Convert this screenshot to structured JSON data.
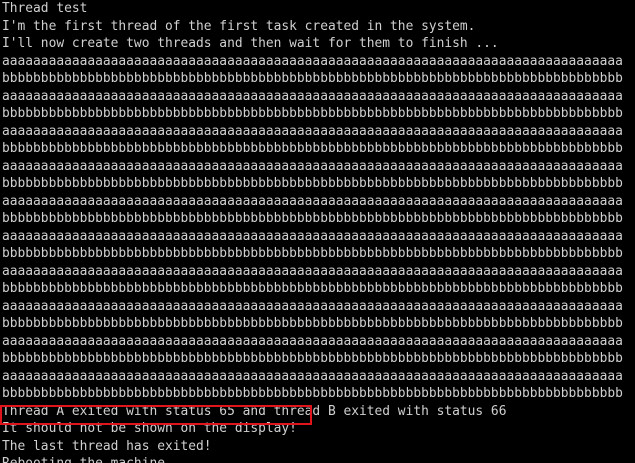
{
  "window": {
    "title": "Thread test"
  },
  "terminal": {
    "lines": [
      "Thread test",
      "I'm the first thread of the first task created in the system.",
      "I'll now create two threads and then wait for them to finish ...",
      "aaaaaaaaaaaaaaaaaaaaaaaaaaaaaaaaaaaaaaaaaaaaaaaaaaaaaaaaaaaaaaaaaaaaaaaaaaaaaaaa",
      "bbbbbbbbbbbbbbbbbbbbbbbbbbbbbbbbbbbbbbbbbbbbbbbbbbbbbbbbbbbbbbbbbbbbbbbbbbbbbbbb",
      "aaaaaaaaaaaaaaaaaaaaaaaaaaaaaaaaaaaaaaaaaaaaaaaaaaaaaaaaaaaaaaaaaaaaaaaaaaaaaaaa",
      "bbbbbbbbbbbbbbbbbbbbbbbbbbbbbbbbbbbbbbbbbbbbbbbbbbbbbbbbbbbbbbbbbbbbbbbbbbbbbbbb",
      "aaaaaaaaaaaaaaaaaaaaaaaaaaaaaaaaaaaaaaaaaaaaaaaaaaaaaaaaaaaaaaaaaaaaaaaaaaaaaaaa",
      "bbbbbbbbbbbbbbbbbbbbbbbbbbbbbbbbbbbbbbbbbbbbbbbbbbbbbbbbbbbbbbbbbbbbbbbbbbbbbbbb",
      "aaaaaaaaaaaaaaaaaaaaaaaaaaaaaaaaaaaaaaaaaaaaaaaaaaaaaaaaaaaaaaaaaaaaaaaaaaaaaaaa",
      "bbbbbbbbbbbbbbbbbbbbbbbbbbbbbbbbbbbbbbbbbbbbbbbbbbbbbbbbbbbbbbbbbbbbbbbbbbbbbbbb",
      "aaaaaaaaaaaaaaaaaaaaaaaaaaaaaaaaaaaaaaaaaaaaaaaaaaaaaaaaaaaaaaaaaaaaaaaaaaaaaaaa",
      "bbbbbbbbbbbbbbbbbbbbbbbbbbbbbbbbbbbbbbbbbbbbbbbbbbbbbbbbbbbbbbbbbbbbbbbbbbbbbbbb",
      "aaaaaaaaaaaaaaaaaaaaaaaaaaaaaaaaaaaaaaaaaaaaaaaaaaaaaaaaaaaaaaaaaaaaaaaaaaaaaaaa",
      "bbbbbbbbbbbbbbbbbbbbbbbbbbbbbbbbbbbbbbbbbbbbbbbbbbbbbbbbbbbbbbbbbbbbbbbbbbbbbbbb",
      "aaaaaaaaaaaaaaaaaaaaaaaaaaaaaaaaaaaaaaaaaaaaaaaaaaaaaaaaaaaaaaaaaaaaaaaaaaaaaaaa",
      "bbbbbbbbbbbbbbbbbbbbbbbbbbbbbbbbbbbbbbbbbbbbbbbbbbbbbbbbbbbbbbbbbbbbbbbbbbbbbbbb",
      "aaaaaaaaaaaaaaaaaaaaaaaaaaaaaaaaaaaaaaaaaaaaaaaaaaaaaaaaaaaaaaaaaaaaaaaaaaaaaaaa",
      "bbbbbbbbbbbbbbbbbbbbbbbbbbbbbbbbbbbbbbbbbbbbbbbbbbbbbbbbbbbbbbbbbbbbbbbbbbbbbbbb",
      "aaaaaaaaaaaaaaaaaaaaaaaaaaaaaaaaaaaaaaaaaaaaaaaaaaaaaaaaaaaaaaaaaaaaaaaaaaaaaaaa",
      "bbbbbbbbbbbbbbbbbbbbbbbbbbbbbbbbbbbbbbbbbbbbbbbbbbbbbbbbbbbbbbbbbbbbbbbbbbbbbbbb",
      "aaaaaaaaaaaaaaaaaaaaaaaaaaaaaaaaaaaaaaaaaaaaaaaaaaaaaaaaaaaaaaaaaaaaaaaaaaaaaaaa",
      "bbbbbbbbbbbbbbbbbbbbbbbbbbbbbbbbbbbbbbbbbbbbbbbbbbbbbbbbbbbbbbbbbbbbbbbbbbbbbbbb",
      "Thread A exited with status 65 and thread B exited with status 66",
      "It should not be shown on the display!",
      "The last thread has exited!",
      "Rebooting the machine ..."
    ]
  },
  "highlight": {
    "color": "#e0141c"
  },
  "colors": {
    "background": "#000000",
    "text": "#d0d0d0"
  }
}
